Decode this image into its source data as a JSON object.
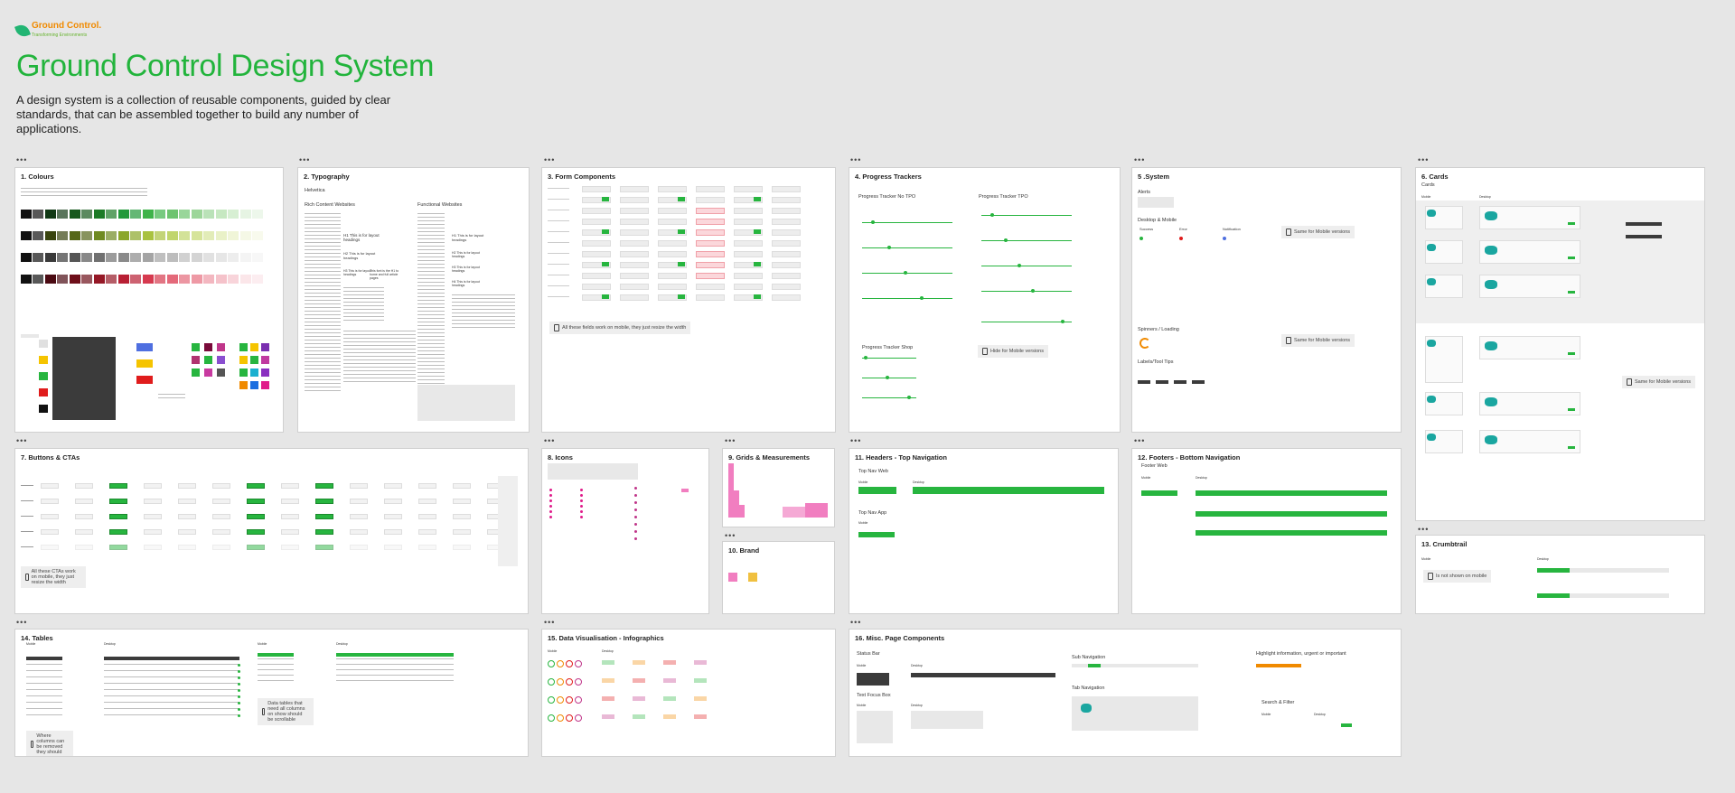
{
  "header": {
    "logo_text": "Ground Control.",
    "logo_sub": "Transforming Environments",
    "title": "Ground Control Design System",
    "description": "A design system is a collection of reusable components, guided by clear standards, that can be assembled together to build any number of applications."
  },
  "colors": {
    "accent": "#22b43c",
    "panel_bg": "#ffffff",
    "page_bg": "#e6e6e6",
    "dark_swatch": "#3b3b3b",
    "orange": "#f08a00",
    "pink": "#f17ec0",
    "teal": "#1aa6a0"
  },
  "panels": {
    "colours": "1. Colours",
    "typography": "2. Typography",
    "form": "3. Form Components",
    "progress": "4. Progress Trackers",
    "system": "5 .System",
    "cards": "6. Cards",
    "buttons": "7. Buttons & CTAs",
    "icons": "8. Icons",
    "grids": "9. Grids & Measurements",
    "brand": "10. Brand",
    "headers": "11. Headers - Top Navigation",
    "footers": "12. Footers - Bottom Navigation",
    "crumbtrail": "13. Crumbtrail",
    "tables": "14. Tables",
    "dataviz": "15. Data Visualisation - Infographics",
    "misc": "16. Misc. Page Components"
  },
  "typography": {
    "font": "Helvetica",
    "rich": "Rich Content Websites",
    "functional": "Functional Websites",
    "h1": "H1 This is for layout headings",
    "h2": "H2 This is for layout headings",
    "h3": "H3 This is for layout headings",
    "h1b": "H1 This is for layout headings",
    "h2b": "H2 This is for layout headings",
    "h3b": "H3 This is for layout headings",
    "h4": "H4 This is for layout headings",
    "note_fonts": "This font is the H1 to home and full article pages"
  },
  "form": {
    "note": "All these fields work on mobile, they just resize the width"
  },
  "progress": {
    "no_tpo": "Progress Tracker No TPO",
    "tpo": "Progress Tracker TPO",
    "shop": "Progress Tracker Shop",
    "hide_note": "Hide for Mobile versions"
  },
  "system": {
    "alerts": "Alerts",
    "desktop_mobile": "Desktop & Mobile",
    "success": "Success",
    "error": "Error",
    "notification": "Notification",
    "spinners": "Spinners / Loading",
    "labels": "Labels/Tool Tips",
    "same_mobile_1": "Same for Mobile versions",
    "same_mobile_2": "Same for Mobile versions"
  },
  "cards": {
    "sub": "Cards",
    "mobile": "Mobile",
    "desktop": "Desktop",
    "same_mobile": "Same for Mobile versions"
  },
  "buttons": {
    "note": "All these CTAs work on mobile, they just resize the width",
    "rows": [
      "Default",
      "Hover",
      "Focused",
      "Pressed",
      "Disabled"
    ]
  },
  "headers": {
    "web": "Top Nav Web",
    "app": "Top Nav App",
    "mobile": "Mobile",
    "desktop": "Desktop"
  },
  "footers": {
    "web": "Footer Web",
    "mobile": "Mobile",
    "desktop": "Desktop"
  },
  "crumbtrail": {
    "mobile": "Mobile",
    "desktop": "Desktop",
    "note": "Is not shown on mobile"
  },
  "tables": {
    "mobile": "Mobile",
    "desktop": "Desktop",
    "note1": "Where columns can be removed they should",
    "note2": "Data tables that need all columns on show should be scrollable"
  },
  "dataviz": {
    "mobile": "Mobile",
    "desktop": "Desktop"
  },
  "misc": {
    "status": "Status Bar",
    "sub_nav": "Sub Navigation",
    "highlight": "Highlight information, urgent or important",
    "text_focus": "Text Focus Box",
    "tab_nav": "Tab Navigation",
    "search_filter": "Search & Filter",
    "mobile": "Mobile",
    "desktop": "Desktop"
  }
}
